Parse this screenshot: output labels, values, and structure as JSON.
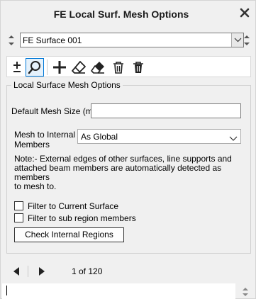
{
  "window": {
    "title": "FE Local Surf. Mesh Options"
  },
  "icons": {
    "close": "close-icon",
    "spin_up": "spin-up-icon",
    "spin_down": "spin-down-icon",
    "chevron": "chevron-down-icon",
    "plus_minus": "plus-minus-icon",
    "search": "search-icon",
    "add": "plus-icon",
    "eraser_outline": "eraser-outline-icon",
    "eraser_filled": "eraser-filled-icon",
    "delete_outline": "trash-outline-icon",
    "delete_filled": "trash-filled-icon",
    "prev": "play-left-icon",
    "next": "play-right-icon"
  },
  "selector": {
    "value": "FE Surface 001"
  },
  "group": {
    "title": "Local Surface Mesh Options",
    "mesh_size": {
      "label": "Default Mesh Size (m)",
      "value": ""
    },
    "mesh_to_internal": {
      "label_line1": "Mesh to Internal",
      "label_line2": "Members",
      "value": "As Global"
    },
    "note_line1": "Note:- External edges of other surfaces, line supports and",
    "note_line2": "attached beam members are automatically detected as members",
    "note_line3": "to mesh to.",
    "filter_current": {
      "label": "Filter to Current Surface",
      "checked": false
    },
    "filter_sub_region": {
      "label": "Filter to sub region members",
      "checked": false
    },
    "check_button": "Check Internal Regions"
  },
  "nav": {
    "page_text": "1 of 120"
  },
  "footer": {
    "value": ""
  },
  "colors": {
    "accent": "#0078d7",
    "background": "#f0f0f0"
  }
}
